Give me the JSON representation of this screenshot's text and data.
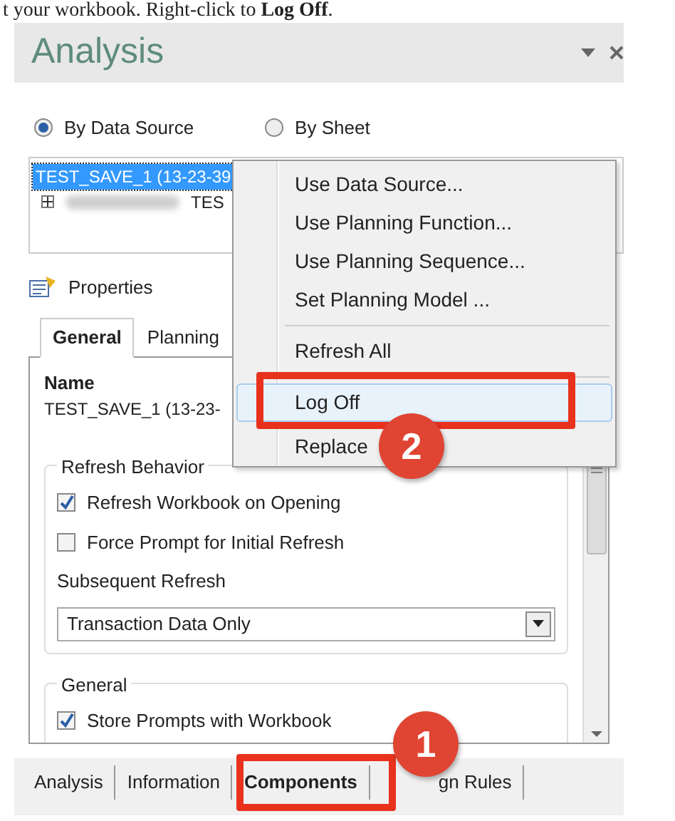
{
  "caption": "t your workbook. Right-click to **Log Off**.",
  "panel": {
    "title": "Analysis",
    "view_options": [
      {
        "label": "By Data Source",
        "selected": true
      },
      {
        "label": "By Sheet",
        "selected": false
      }
    ],
    "tree": [
      {
        "label": "TEST_SAVE_1 (13-23-39",
        "selected": true,
        "children": [
          {
            "label": "TES",
            "selected": false,
            "expanded": false
          }
        ]
      }
    ],
    "context_menu": [
      {
        "kind": "item",
        "label": "Use Data Source...",
        "highlighted": false
      },
      {
        "kind": "item",
        "label": "Use Planning Function...",
        "highlighted": false
      },
      {
        "kind": "item",
        "label": "Use Planning Sequence...",
        "highlighted": false
      },
      {
        "kind": "item",
        "label": "Set Planning Model ...",
        "highlighted": false
      },
      {
        "kind": "separator"
      },
      {
        "kind": "item",
        "label": "Refresh All",
        "highlighted": false
      },
      {
        "kind": "separator"
      },
      {
        "kind": "item",
        "label": "Log Off",
        "highlighted": true
      },
      {
        "kind": "item",
        "label": "Replace",
        "highlighted": false
      }
    ],
    "properties": {
      "heading": "Properties",
      "tabs": [
        {
          "label": "General",
          "selected": true
        },
        {
          "label": "Planning",
          "selected": false
        }
      ],
      "name_label": "Name",
      "name_value": "TEST_SAVE_1 (13-23-",
      "groups": [
        {
          "title": "Refresh Behavior",
          "checkboxes": [
            {
              "label": "Refresh Workbook on Opening",
              "checked": true
            },
            {
              "label": "Force Prompt for Initial Refresh",
              "checked": false
            }
          ],
          "dropdown_label": "Subsequent Refresh",
          "dropdown_value": "Transaction Data Only"
        },
        {
          "title": "General",
          "checkboxes": [
            {
              "label": "Store Prompts with Workbook",
              "checked": true
            }
          ]
        }
      ]
    },
    "bottom_tabs": [
      {
        "label": "Analysis",
        "selected": false
      },
      {
        "label": "Information",
        "selected": false
      },
      {
        "label": "Components",
        "selected": true
      },
      {
        "label": "gn Rules",
        "selected": false
      }
    ]
  },
  "callouts": [
    {
      "label": "1"
    },
    {
      "label": "2"
    }
  ]
}
